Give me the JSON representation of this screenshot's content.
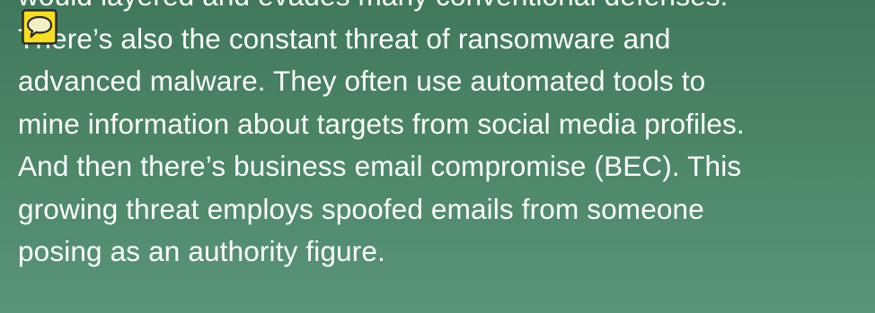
{
  "slide": {
    "paragraph": [
      "would layered and evades many conventional defenses.",
      "There’s also the constant threat of ransomware and",
      "advanced malware. They often use automated tools to",
      "mine information about targets from social media profiles.",
      "And then there’s business email compromise (BEC). This",
      "growing threat employs spoofed emails from someone",
      "posing as an authority figure."
    ]
  },
  "comment_marker": {
    "icon": "speech-bubble-icon",
    "fill_color": "#f7df1e",
    "border_color": "#2a2a2a"
  },
  "colors": {
    "background_top": "#40785c",
    "background_bottom": "#5a957a",
    "text": "#ffffff"
  }
}
